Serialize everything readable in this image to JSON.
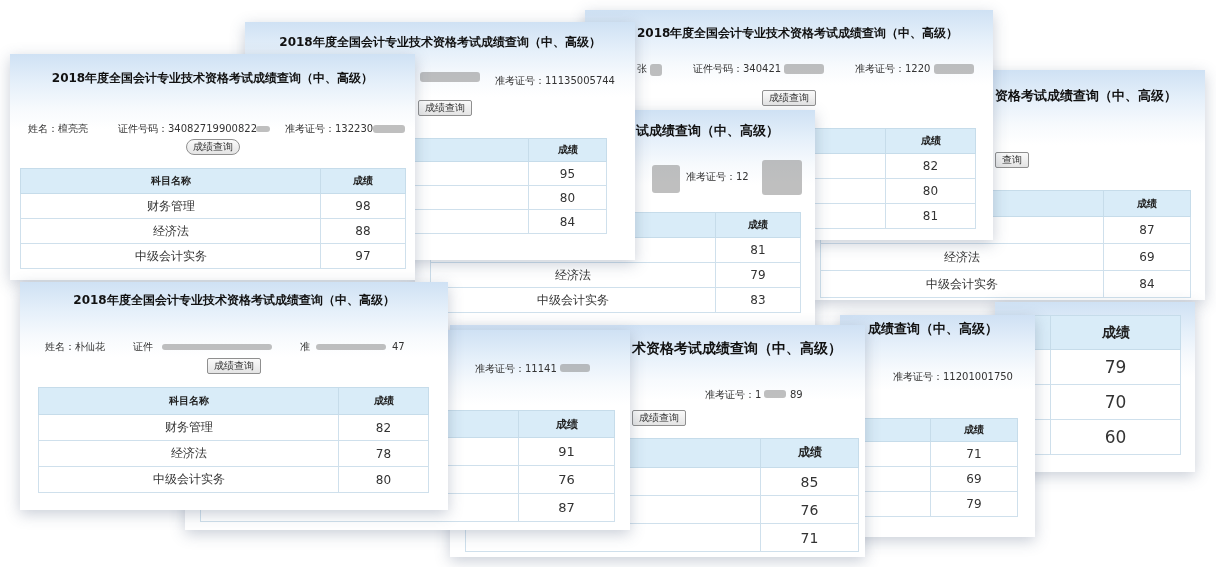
{
  "cards": [
    {
      "title": "2018年度全国会计专业技术资格考试成绩查询（中、高级）",
      "fields": [
        "姓名：檀亮亮",
        "证件号码：34082719900822",
        "准考证号：132230"
      ],
      "button": "成绩查询",
      "table": {
        "subject_heading": "科目名称",
        "score_heading": "成绩",
        "rows": [
          {
            "subject": "财务管理",
            "score": "98"
          },
          {
            "subject": "经济法",
            "score": "88"
          },
          {
            "subject": "中级会计实务",
            "score": "97"
          }
        ]
      }
    },
    {
      "title": "2018年度全国会计专业技术资格考试成绩查询（中、高级）",
      "fields": [
        "准考证号：11135005744"
      ],
      "button": "成绩查询",
      "table": {
        "score_heading": "成绩",
        "rows": [
          {
            "score": "95"
          },
          {
            "score": "80"
          },
          {
            "score": "84"
          }
        ]
      }
    },
    {
      "title": "2018年度全国会计专业技术资格考试成绩查询（中、高级）",
      "fields": [
        "张",
        "证件号码：340421",
        "准考证号：1220"
      ],
      "button": "成绩查询",
      "table": {
        "score_heading": "成绩",
        "rows": [
          {
            "score": "82"
          },
          {
            "score": "80"
          },
          {
            "score": "81"
          }
        ]
      }
    },
    {
      "title": "资格考试成绩查询（中、高级）",
      "button": "查询",
      "table": {
        "score_heading": "成绩",
        "rows": [
          {
            "score": "87"
          },
          {
            "subject": "经济法",
            "score": "69"
          },
          {
            "subject": "中级会计实务",
            "score": "84"
          }
        ]
      }
    },
    {
      "title": "试成绩查询（中、高级）",
      "fields": [
        "准考证号：12"
      ],
      "table": {
        "score_heading": "成绩",
        "rows": [
          {
            "score": "81"
          },
          {
            "subject": "经济法",
            "score": "79"
          },
          {
            "subject": "中级会计实务",
            "score": "83"
          }
        ]
      }
    },
    {
      "title": "2018年度全国会计专业技术资格考试成绩查询（中、高级）",
      "fields": [
        "姓名：朴仙花",
        "证件",
        "准",
        "47"
      ],
      "button": "成绩查询",
      "table": {
        "subject_heading": "科目名称",
        "score_heading": "成绩",
        "rows": [
          {
            "subject": "财务管理",
            "score": "82"
          },
          {
            "subject": "经济法",
            "score": "78"
          },
          {
            "subject": "中级会计实务",
            "score": "80"
          }
        ]
      }
    },
    {
      "fields": [
        "准考证号：11141"
      ],
      "table": {
        "score_heading": "成绩",
        "rows": [
          {
            "score": "91"
          },
          {
            "score": "76"
          },
          {
            "score": "87"
          }
        ]
      }
    },
    {
      "title": "术资格考试成绩查询（中、高级）",
      "fields": [
        "准考证号：1",
        "89"
      ],
      "button": "成绩查询",
      "table": {
        "score_heading": "成绩",
        "rows": [
          {
            "score": "85"
          },
          {
            "score": "76"
          },
          {
            "score": "71"
          }
        ]
      }
    },
    {
      "title": "成绩查询（中、高级）",
      "fields": [
        "准考证号：11201001750"
      ],
      "table": {
        "score_heading": "成绩",
        "rows": [
          {
            "score": "71"
          },
          {
            "score": "69"
          },
          {
            "score": "79"
          }
        ]
      }
    },
    {
      "table": {
        "score_heading": "成绩",
        "rows": [
          {
            "score": "79"
          },
          {
            "score": "70"
          },
          {
            "score": "60"
          }
        ]
      }
    }
  ]
}
